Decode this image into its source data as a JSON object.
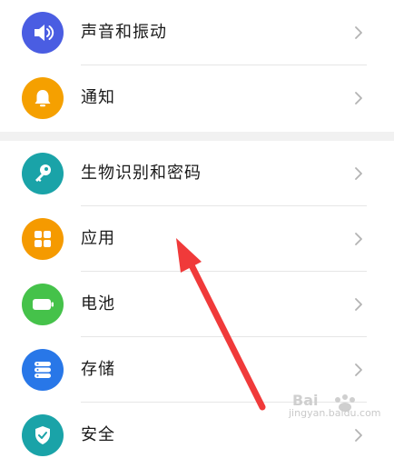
{
  "group1": {
    "items": [
      {
        "label": "声音和振动",
        "icon": "speaker-icon",
        "color": "#4a5de2"
      },
      {
        "label": "通知",
        "icon": "bell-icon",
        "color": "#f5a000"
      }
    ]
  },
  "group2": {
    "items": [
      {
        "label": "生物识别和密码",
        "icon": "key-icon",
        "color": "#1aa3a8"
      },
      {
        "label": "应用",
        "icon": "apps-grid-icon",
        "color": "#f59a00"
      },
      {
        "label": "电池",
        "icon": "battery-icon",
        "color": "#45c24a"
      },
      {
        "label": "存储",
        "icon": "storage-icon",
        "color": "#2877e8"
      },
      {
        "label": "安全",
        "icon": "shield-icon",
        "color": "#1aa3a8"
      }
    ]
  },
  "annotation": {
    "color": "#f03a3a"
  },
  "watermark": {
    "brand": "Bai",
    "site": "jingyan.baidu.com"
  }
}
